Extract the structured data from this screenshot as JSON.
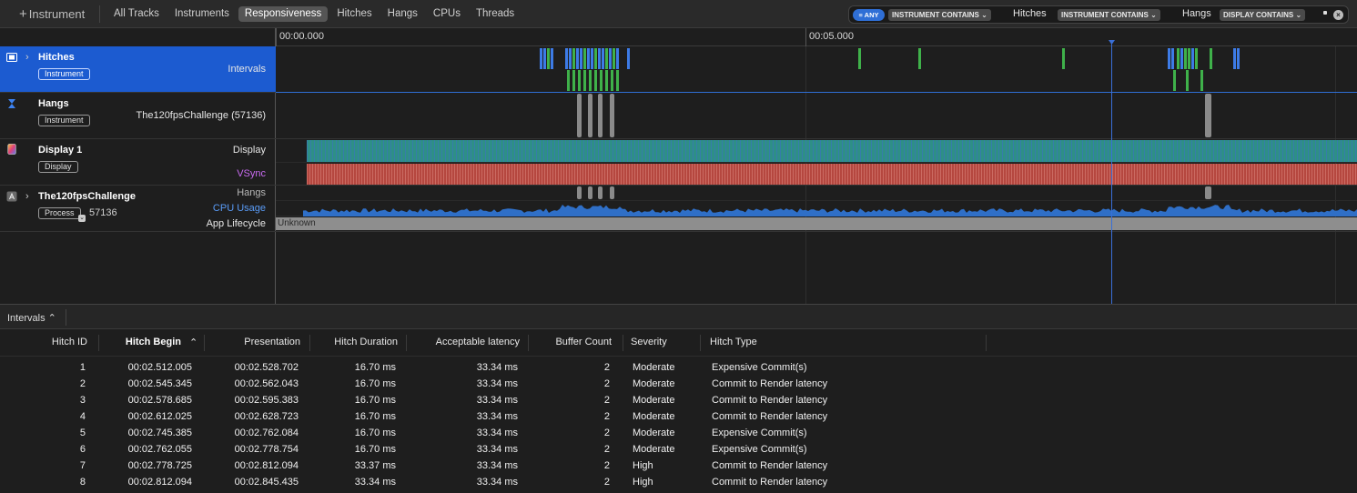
{
  "toolbar": {
    "add_instrument_label": "Instrument",
    "tabs": [
      "All Tracks",
      "Instruments",
      "Responsiveness",
      "Hitches",
      "Hangs",
      "CPUs",
      "Threads"
    ],
    "active_tab": "Responsiveness",
    "filter": {
      "any_label": "ANY",
      "tokens": [
        {
          "field": "INSTRUMENT CONTAINS",
          "value": "Hitches"
        },
        {
          "field": "INSTRUMENT CONTAINS",
          "value": "Hangs"
        },
        {
          "field": "DISPLAY CONTAINS",
          "value": ""
        }
      ]
    }
  },
  "timeline": {
    "ruler_labels": [
      "00:00.000",
      "00:05.000"
    ]
  },
  "tracks": [
    {
      "title": "Hitches",
      "badge": "Instrument",
      "sublabels": [
        "Intervals"
      ],
      "icon": "film-icon",
      "selected": true
    },
    {
      "title": "Hangs",
      "badge": "Instrument",
      "sublabels": [
        "The120fpsChallenge (57136)"
      ],
      "icon": "hourglass-icon",
      "selected": false
    },
    {
      "title": "Display 1",
      "badge": "Display",
      "sublabels": [
        "Display",
        "VSync"
      ],
      "icon": "display-icon",
      "selected": false
    },
    {
      "title": "The120fpsChallenge",
      "badge": "Process",
      "pid": "57136",
      "sublabels": [
        "Hangs",
        "CPU Usage",
        "App Lifecycle"
      ],
      "icon": "app-icon",
      "selected": false
    }
  ],
  "lifecycle_state": "Unknown",
  "detail": {
    "selector_label": "Intervals",
    "columns": [
      "Hitch ID",
      "Hitch Begin",
      "Presentation",
      "Hitch Duration",
      "Acceptable latency",
      "Buffer Count",
      "Severity",
      "Hitch Type"
    ],
    "sorted_column": "Hitch Begin",
    "rows": [
      {
        "id": "1",
        "begin": "00:02.512.005",
        "presentation": "00:02.528.702",
        "duration": "16.70 ms",
        "latency": "33.34 ms",
        "buffers": "2",
        "severity": "Moderate",
        "type": "Expensive Commit(s)"
      },
      {
        "id": "2",
        "begin": "00:02.545.345",
        "presentation": "00:02.562.043",
        "duration": "16.70 ms",
        "latency": "33.34 ms",
        "buffers": "2",
        "severity": "Moderate",
        "type": "Commit to Render latency"
      },
      {
        "id": "3",
        "begin": "00:02.578.685",
        "presentation": "00:02.595.383",
        "duration": "16.70 ms",
        "latency": "33.34 ms",
        "buffers": "2",
        "severity": "Moderate",
        "type": "Commit to Render latency"
      },
      {
        "id": "4",
        "begin": "00:02.612.025",
        "presentation": "00:02.628.723",
        "duration": "16.70 ms",
        "latency": "33.34 ms",
        "buffers": "2",
        "severity": "Moderate",
        "type": "Commit to Render latency"
      },
      {
        "id": "5",
        "begin": "00:02.745.385",
        "presentation": "00:02.762.084",
        "duration": "16.70 ms",
        "latency": "33.34 ms",
        "buffers": "2",
        "severity": "Moderate",
        "type": "Expensive Commit(s)"
      },
      {
        "id": "6",
        "begin": "00:02.762.055",
        "presentation": "00:02.778.754",
        "duration": "16.70 ms",
        "latency": "33.34 ms",
        "buffers": "2",
        "severity": "Moderate",
        "type": "Expensive Commit(s)"
      },
      {
        "id": "7",
        "begin": "00:02.778.725",
        "presentation": "00:02.812.094",
        "duration": "33.37 ms",
        "latency": "33.34 ms",
        "buffers": "2",
        "severity": "High",
        "type": "Commit to Render latency"
      },
      {
        "id": "8",
        "begin": "00:02.812.094",
        "presentation": "00:02.845.435",
        "duration": "33.34 ms",
        "latency": "33.34 ms",
        "buffers": "2",
        "severity": "High",
        "type": "Commit to Render latency"
      }
    ]
  },
  "colors": {
    "selection": "#1c5bd0",
    "hitch_blue": "#3d7be6",
    "hitch_green": "#3fb14a",
    "hang_gray": "#8a8a8a",
    "display_teal": "#2e8f86",
    "vsync_red": "#b5473f",
    "cpu_blue": "#2f6fc7"
  }
}
